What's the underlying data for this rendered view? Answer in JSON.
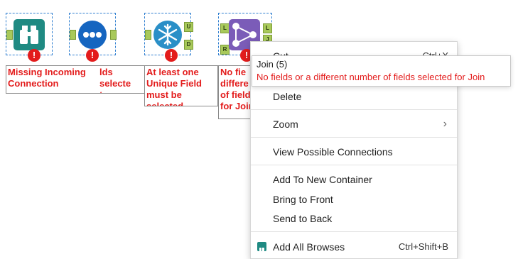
{
  "canvas": {
    "tools": [
      {
        "name": "Browse",
        "error_label": "Missing Incoming\nConnection",
        "color": "#1f8a82"
      },
      {
        "name": "Select",
        "error_label": "lds selecte\nt",
        "color": "#1565c0"
      },
      {
        "name": "Unique",
        "error_label": "At least one\nUnique Field\nmust be selected",
        "color": "#2a8fc7"
      },
      {
        "name": "Join",
        "error_label": "No fie\ndiffere\nof field\nfor Join",
        "color": "#7b5cb8"
      }
    ],
    "error_glyph": "!",
    "anchor_labels": {
      "unique_u": "U",
      "unique_d": "D",
      "join_l": "L",
      "join_r": "R",
      "join_j": "J",
      "join_l2": "L"
    }
  },
  "tooltip": {
    "title": "Join (5)",
    "message": "No fields or a different number of fields selected for Join"
  },
  "context_menu": {
    "items": [
      {
        "label": "Cut",
        "shortcut": "Ctrl+X"
      },
      {
        "label": "Delete"
      },
      {
        "label": "Zoom",
        "submenu_glyph": "›"
      },
      {
        "label": "View Possible Connections"
      },
      {
        "label": "Add To New Container"
      },
      {
        "label": "Bring to Front"
      },
      {
        "label": "Send to Back"
      },
      {
        "label": "Add All Browses",
        "shortcut": "Ctrl+Shift+B"
      }
    ]
  },
  "colors": {
    "error": "#e31c1c",
    "selection": "#2f7fd0",
    "anchor": "#a8c95a"
  }
}
